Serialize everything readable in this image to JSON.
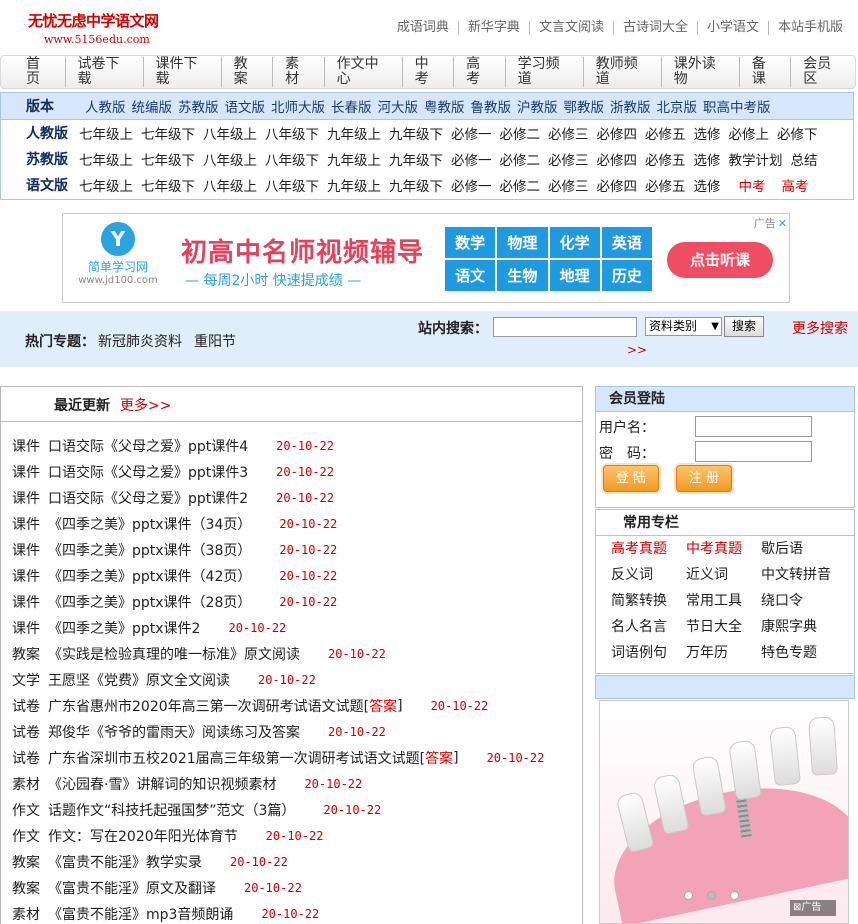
{
  "header": {
    "site_title": "无忧无虑中学语文网",
    "site_url": "www.5156edu.com",
    "top_links": [
      "成语词典",
      "新华字典",
      "文言文阅读",
      "古诗词大全",
      "小学语文",
      "本站手机版"
    ]
  },
  "main_nav": [
    "首页",
    "试卷下载",
    "课件下载",
    "教案",
    "素材",
    "作文中心",
    "中考",
    "高考",
    "学习频道",
    "教师频道",
    "课外读物",
    "备课",
    "会员区"
  ],
  "versions": {
    "head_label": "版本",
    "editions": [
      "人教版",
      "统编版",
      "苏教版",
      "语文版",
      "北师大版",
      "长春版",
      "河大版",
      "粤教版",
      "鲁教版",
      "沪教版",
      "鄂教版",
      "浙教版",
      "北京版",
      "职高中考版"
    ],
    "rows": [
      {
        "label": "人教版",
        "items": [
          "七年级上",
          "七年级下",
          "八年级上",
          "八年级下",
          "九年级上",
          "九年级下",
          "必修一",
          "必修二",
          "必修三",
          "必修四",
          "必修五",
          "选修",
          "必修上",
          "必修下"
        ],
        "extra": []
      },
      {
        "label": "苏教版",
        "items": [
          "七年级上",
          "七年级下",
          "八年级上",
          "八年级下",
          "九年级上",
          "九年级下",
          "必修一",
          "必修二",
          "必修三",
          "必修四",
          "必修五",
          "选修",
          "教学计划",
          "总结"
        ],
        "extra": []
      },
      {
        "label": "语文版",
        "items": [
          "七年级上",
          "七年级下",
          "八年级上",
          "八年级下",
          "九年级上",
          "九年级下",
          "必修一",
          "必修二",
          "必修三",
          "必修四",
          "必修五",
          "选修"
        ],
        "extra": [
          "中考",
          "高考"
        ]
      }
    ]
  },
  "ad_banner": {
    "logo_glyph": "Y",
    "logo_name": "简单学习网",
    "logo_url": "www.jd100.com",
    "headline": "初高中名师视频辅导",
    "subline": "— 每周2小时  快速提成绩 —",
    "subjects": [
      "数学",
      "物理",
      "化学",
      "英语",
      "语文",
      "生物",
      "地理",
      "历史"
    ],
    "cta": "点击听课",
    "tag": "广告",
    "close": "✕"
  },
  "hot_bar": {
    "label": "热门专题：",
    "topics": [
      "新冠肺炎资料",
      "重阳节"
    ],
    "search_label": "站内搜索：",
    "search_value": "",
    "category": "资料类别",
    "search_button": "搜索",
    "more_search": "更多搜索",
    "more_arrow": ">>"
  },
  "latest": {
    "title": "最近更新",
    "more": "更多>>",
    "items": [
      {
        "cat": "课件",
        "title": "口语交际《父母之爱》ppt课件4",
        "ans": "",
        "tail": "",
        "date": "20-10-22"
      },
      {
        "cat": "课件",
        "title": "口语交际《父母之爱》ppt课件3",
        "ans": "",
        "tail": "",
        "date": "20-10-22"
      },
      {
        "cat": "课件",
        "title": "口语交际《父母之爱》ppt课件2",
        "ans": "",
        "tail": "",
        "date": "20-10-22"
      },
      {
        "cat": "课件",
        "title": "《四季之美》pptx课件（34页）",
        "ans": "",
        "tail": "",
        "date": "20-10-22"
      },
      {
        "cat": "课件",
        "title": "《四季之美》pptx课件（38页）",
        "ans": "",
        "tail": "",
        "date": "20-10-22"
      },
      {
        "cat": "课件",
        "title": "《四季之美》pptx课件（42页）",
        "ans": "",
        "tail": "",
        "date": "20-10-22"
      },
      {
        "cat": "课件",
        "title": "《四季之美》pptx课件（28页）",
        "ans": "",
        "tail": "",
        "date": "20-10-22"
      },
      {
        "cat": "课件",
        "title": "《四季之美》pptx课件2",
        "ans": "",
        "tail": "",
        "date": "20-10-22"
      },
      {
        "cat": "教案",
        "title": "《实践是检验真理的唯一标准》原文阅读",
        "ans": "",
        "tail": "",
        "date": "20-10-22"
      },
      {
        "cat": "文学",
        "title": "王愿坚《党费》原文全文阅读",
        "ans": "",
        "tail": "",
        "date": "20-10-22"
      },
      {
        "cat": "试卷",
        "title": "广东省惠州市2020年高三第一次调研考试语文试题[",
        "ans": "答案",
        "tail": "]",
        "date": "20-10-22"
      },
      {
        "cat": "试卷",
        "title": "郑俊华《爷爷的雷雨天》阅读练习及答案",
        "ans": "",
        "tail": "",
        "date": "20-10-22"
      },
      {
        "cat": "试卷",
        "title": "广东省深圳市五校2021届高三年级第一次调研考试语文试题[",
        "ans": "答案",
        "tail": "]",
        "date": "20-10-22"
      },
      {
        "cat": "素材",
        "title": "《沁园春·雪》讲解词的知识视频素材",
        "ans": "",
        "tail": "",
        "date": "20-10-22"
      },
      {
        "cat": "作文",
        "title": "话题作文“科技托起强国梦”范文（3篇）",
        "ans": "",
        "tail": "",
        "date": "20-10-22"
      },
      {
        "cat": "作文",
        "title": "作文：写在2020年阳光体育节",
        "ans": "",
        "tail": "",
        "date": "20-10-22"
      },
      {
        "cat": "教案",
        "title": "《富贵不能淫》教学实录",
        "ans": "",
        "tail": "",
        "date": "20-10-22"
      },
      {
        "cat": "教案",
        "title": "《富贵不能淫》原文及翻译",
        "ans": "",
        "tail": "",
        "date": "20-10-22"
      },
      {
        "cat": "素材",
        "title": "《富贵不能淫》mp3音频朗诵",
        "ans": "",
        "tail": "",
        "date": "20-10-22"
      }
    ]
  },
  "login": {
    "title": "会员登陆",
    "username_label": "用户名：",
    "password_label": "密　码：",
    "login_button": "登 陆",
    "register_button": "注 册"
  },
  "common": {
    "title": "常用专栏",
    "items": [
      {
        "label": "高考真题",
        "red": true
      },
      {
        "label": "中考真题",
        "red": true
      },
      {
        "label": "歇后语",
        "red": false
      },
      {
        "label": "反义词",
        "red": false
      },
      {
        "label": "近义词",
        "red": false
      },
      {
        "label": "中文转拼音",
        "red": false
      },
      {
        "label": "简繁转换",
        "red": false
      },
      {
        "label": "常用工具",
        "red": false
      },
      {
        "label": "绕口令",
        "red": false
      },
      {
        "label": "名人名言",
        "red": false
      },
      {
        "label": "节日大全",
        "red": false
      },
      {
        "label": "康熙字典",
        "red": false
      },
      {
        "label": "词语例句",
        "red": false
      },
      {
        "label": "万年历",
        "red": false
      },
      {
        "label": "特色专题",
        "red": false
      }
    ]
  },
  "side_ad": {
    "tag": "广告"
  },
  "colors": {
    "brand_red": "#d10000",
    "link_red": "#cc0000",
    "panel_blue": "#d6e7fb",
    "border_blue": "#a9c7e4"
  }
}
